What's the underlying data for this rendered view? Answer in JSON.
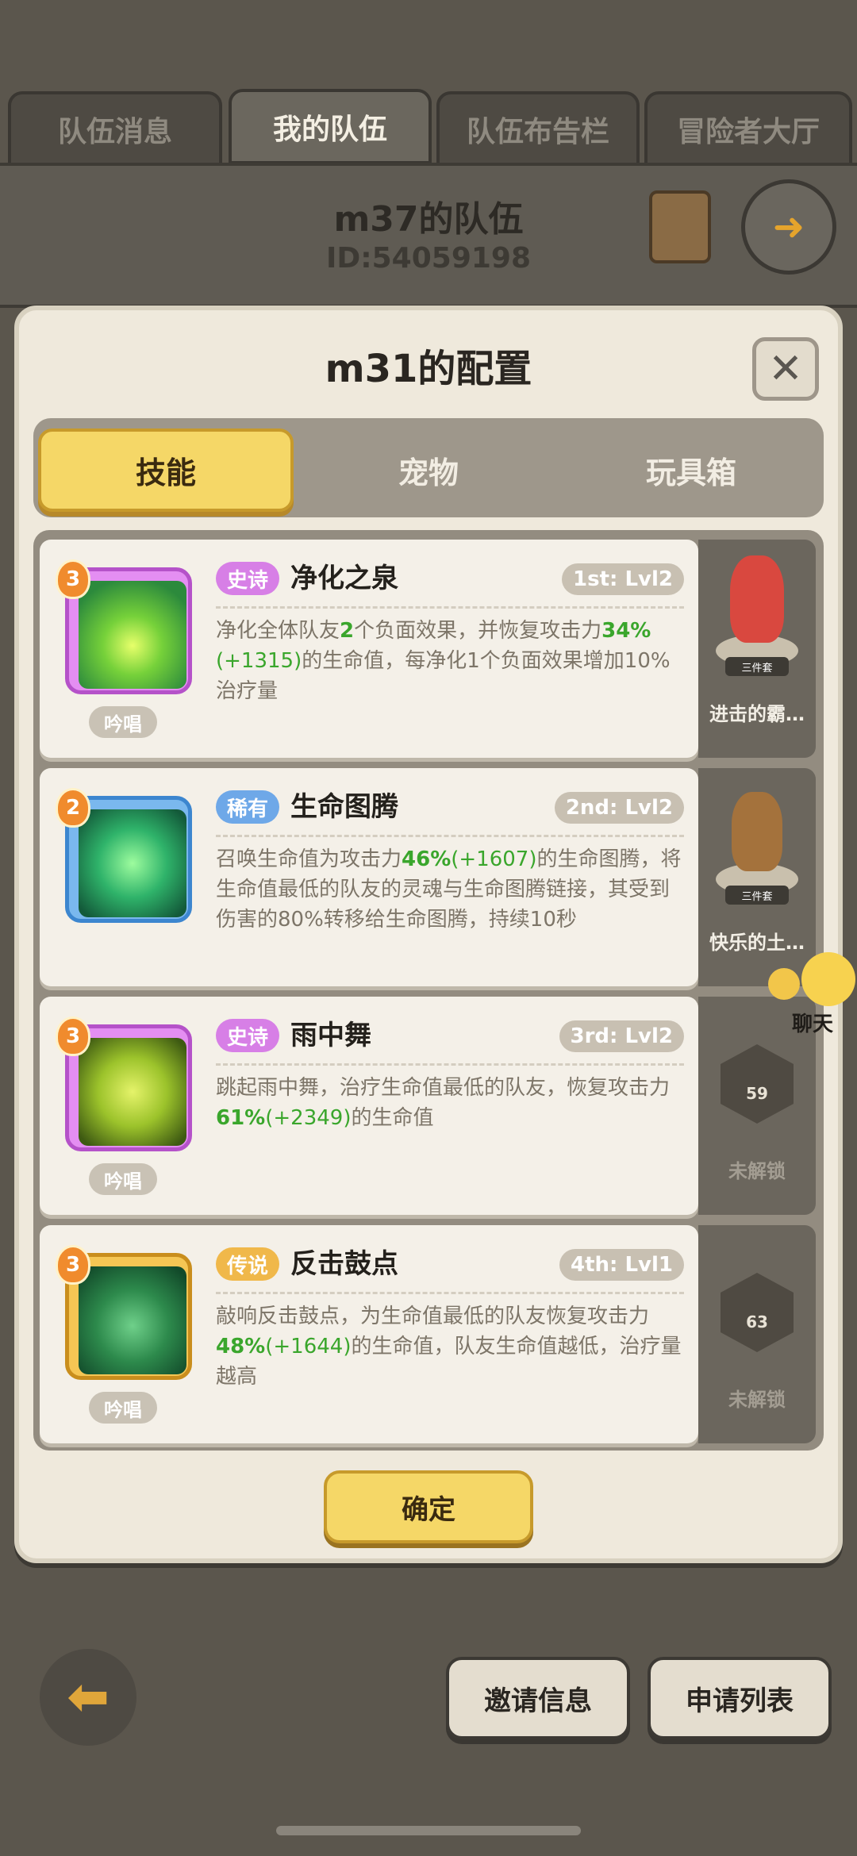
{
  "top_tabs": [
    {
      "label": "队伍消息"
    },
    {
      "label": "我的队伍"
    },
    {
      "label": "队伍布告栏"
    },
    {
      "label": "冒险者大厅"
    }
  ],
  "team": {
    "name": "m37的队伍",
    "id": "ID:54059198"
  },
  "modal": {
    "title": "m31的配置",
    "close_label": "✕",
    "tabs": [
      {
        "label": "技能"
      },
      {
        "label": "宠物"
      },
      {
        "label": "玩具箱"
      }
    ],
    "skills": [
      {
        "level": "3",
        "chant": "吟唱",
        "rarity": "史诗",
        "name": "净化之泉",
        "slot_level": "1st: Lvl2",
        "desc_parts": [
          "净化全体队友",
          "2",
          "个负面效果，并恢复攻击力",
          "34%",
          "(+1315)",
          "的生命值，每净化1个负面效果增加10%治疗量"
        ]
      },
      {
        "level": "2",
        "chant": "",
        "rarity": "稀有",
        "name": "生命图腾",
        "slot_level": "2nd: Lvl2",
        "desc_parts": [
          "召唤生命值为攻击力",
          "46%",
          "(+1607)",
          "的生命图腾，将生命值最低的队友的灵魂与生命图腾链接，其受到伤害的80%转移给生命图腾，持续10秒"
        ]
      },
      {
        "level": "3",
        "chant": "吟唱",
        "rarity": "史诗",
        "name": "雨中舞",
        "slot_level": "3rd: Lvl2",
        "desc_parts": [
          "跳起雨中舞，治疗生命值最低的队友，恢复攻击力",
          "61%",
          "(+2349)",
          "的生命值"
        ]
      },
      {
        "level": "3",
        "chant": "吟唱",
        "rarity": "传说",
        "name": "反击鼓点",
        "slot_level": "4th: Lvl1",
        "desc_parts": [
          "敲响反击鼓点，为生命值最低的队友恢复攻击力",
          "48%",
          "(+1644)",
          "的生命值，队友生命值越低，治疗量越高"
        ]
      }
    ],
    "side": [
      {
        "label": "进击的霸…",
        "tag": "三件套"
      },
      {
        "label": "快乐的土…",
        "tag": "三件套"
      },
      {
        "label": "未解锁",
        "num": "59"
      },
      {
        "label": "未解锁",
        "num": "63"
      }
    ],
    "confirm_label": "确定"
  },
  "chat_label": "聊天",
  "bottom": {
    "invite_label": "邀请信息",
    "apply_label": "申请列表"
  },
  "colors": {
    "epic": "#d77fe6",
    "rare": "#6ea8e8",
    "legend": "#f0b84a",
    "highlight": "#3aa62c",
    "accent": "#f5d767"
  }
}
